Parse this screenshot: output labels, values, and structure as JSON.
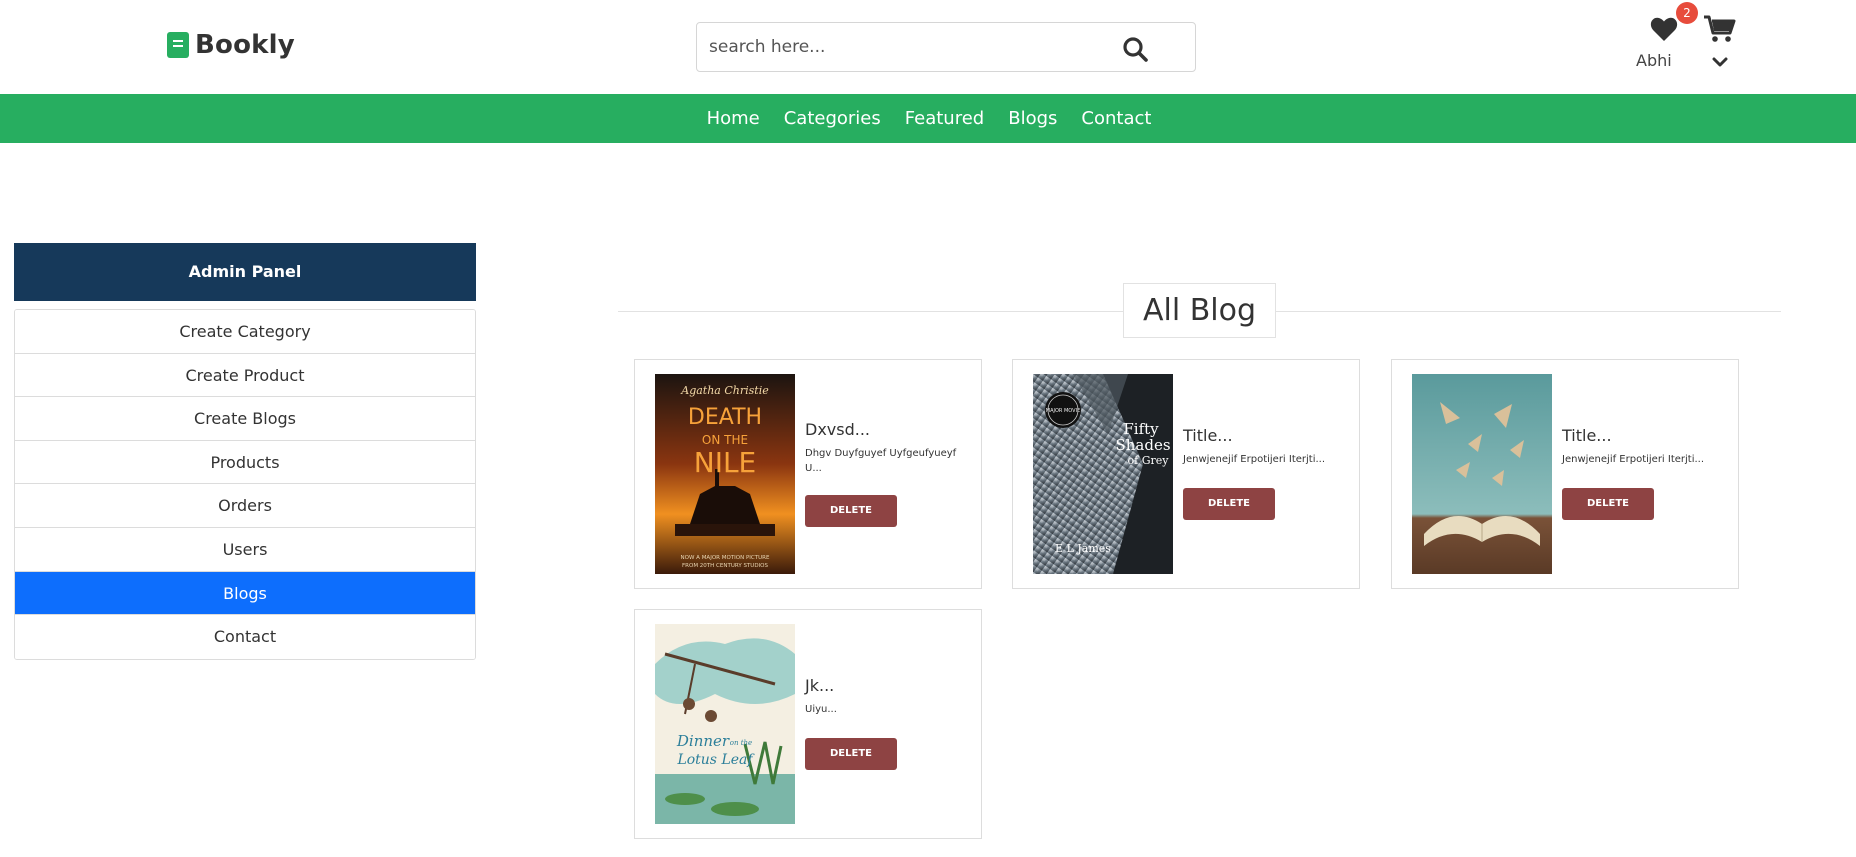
{
  "header": {
    "logo_text": "Bookly",
    "search_placeholder": "search here...",
    "wishlist_count": "2",
    "user_name": "Abhi"
  },
  "nav": {
    "items": [
      "Home",
      "Categories",
      "Featured",
      "Blogs",
      "Contact"
    ]
  },
  "sidebar": {
    "title": "Admin Panel",
    "items": [
      "Create Category",
      "Create Product",
      "Create Blogs",
      "Products",
      "Orders",
      "Users",
      "Blogs",
      "Contact"
    ],
    "active": "Blogs"
  },
  "main": {
    "section_title": "All Blog",
    "blogs": [
      {
        "title": "Dxvsd...",
        "desc": "Dhgv Duyfguyef Uyfgeufyueyf U...",
        "button": "DELETE",
        "cover": "death-on-the-nile-cover",
        "cover_texts": [
          "Agatha Christie",
          "DEATH",
          "ON THE",
          "NILE",
          "NOW A MAJOR MOTION PICTURE",
          "FROM 20TH CENTURY STUDIOS"
        ]
      },
      {
        "title": "Title...",
        "desc": "Jenwjenejif Erpotijeri Iterjti...",
        "button": "DELETE",
        "cover": "fifty-shades-cover",
        "cover_texts": [
          "Fifty",
          "Shades",
          "of Grey",
          "E L James",
          "MAJOR MOVIE"
        ]
      },
      {
        "title": "Title...",
        "desc": "Jenwjenejif Erpotijeri Iterjti...",
        "button": "DELETE",
        "cover": "paper-planes-book-image"
      },
      {
        "title": "Jk...",
        "desc": "Uiyu...",
        "button": "DELETE",
        "cover": "dinner-on-lotus-leaf-cover",
        "cover_texts": [
          "Dinner",
          "on the",
          "Lotus Leaf"
        ]
      }
    ]
  },
  "colors": {
    "brand_green": "#27ae60",
    "admin_header": "#16395a",
    "active_blue": "#0d6efd",
    "delete_button": "#8e4343",
    "badge_red": "#e74c3c"
  }
}
